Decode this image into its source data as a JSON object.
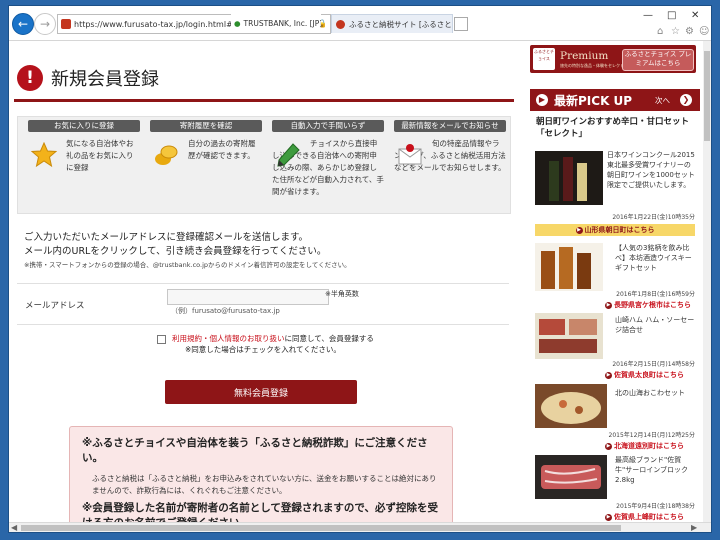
{
  "browser": {
    "url": "https://www.furusato-tax.jp/login.html#registration",
    "addr_tools": "⌕ ▾ 🔒",
    "tab_cert": "TRUSTBANK, Inc. [JP]",
    "tab_active": "ふるさと納税サイト [ふるさとチョ...",
    "tab_close": "×"
  },
  "page": {
    "title": "新規会員登録",
    "features": [
      {
        "label": "お気に入りに登録",
        "text": "気になる自治体やお礼の品をお気に入りに登録"
      },
      {
        "label": "寄附履歴を確認",
        "text": "自分の過去の寄附履歴が確認できます。"
      },
      {
        "label": "自動入力で手間いらず",
        "text": "チョイスから直接申し込みできる自治体への寄附申し込みの際、あらかじめ登録した住所などが自動入力されて、手間が省けます。"
      },
      {
        "label": "最新情報をメールでお知らせ",
        "text": "旬の特産品情報やランキング、ふるさと納税活用方法などをメールでお知らせします。"
      }
    ],
    "info_line1": "ご入力いただいたメールアドレスに登録確認メールを送信します。",
    "info_line2": "メール内のURLをクリックして、引き続き会員登録を行ってください。",
    "info_note": "※携帯・スマートフォンからの登録の場合、@trustbank.co.jpからのドメイン着信許可の設定をしてください。",
    "form": {
      "label": "メールアドレス",
      "required": "※半角英数",
      "example": "（例）furusato@furusato-tax.jp",
      "value": ""
    },
    "agree": {
      "link": "利用規約・個人情報のお取り扱い",
      "rest": "に同意して、会員登録する",
      "note": "※同意した場合はチェックを入れてください。"
    },
    "register_button": "無料会員登録",
    "warning": {
      "title1": "※ふるさとチョイスや自治体を装う「ふるさと納税詐欺」にご注意ください。",
      "para1": "ふるさと納税は「ふるさと納税」をお申込みをされていない方に、送金をお願いすることは絶対にありませんので、詐欺行為には、くれぐれもご注意ください。",
      "title2": "※会員登録した名前が寄附者の名前として登録されますので、必ず控除を受ける方のお名前でご登録ください。"
    }
  },
  "sidebar": {
    "premium_logo": "ふるさとチョイス",
    "premium_word": "Premium",
    "premium_sub": "旅先の特別な逸品・体験をセレクト",
    "premium_btn": "ふるさとチョイス プレミアムはこちら",
    "pick_title": "最新PICK UP",
    "pick_next": "次へ",
    "feature_title": "朝日町ワインおすすめ辛口・甘口セット「セレクト」",
    "items": [
      {
        "desc": "日本ワインコンクール2015東北最多受賞ワイナリーの朝日町ワインを1000セット限定でご提供いたします。",
        "date": "2016年1月22日(金)10時35分",
        "shop": "山形県朝日町はこちら"
      },
      {
        "desc": "【人気の3銘柄を飲み比べ】本坊酒造ウイスキーギフトセット",
        "date": "2016年1月8日(金)16時59分",
        "shop": "長野県宮ケ根市はこちら"
      },
      {
        "desc": "山崎ハム ハム・ソーセージ詰合せ",
        "date": "2016年2月15日(月)14時58分",
        "shop": "佐賀県太良町はこちら"
      },
      {
        "desc": "北の山海おこわセット",
        "date": "2015年12月14日(月)12時25分",
        "shop": "北海道遠別町はこちら"
      },
      {
        "desc": "最高級ブランド\"佐賀牛\"サーロインブロック2.8kg",
        "date": "2015年9月4日(金)18時38分",
        "shop": "佐賀県上峰町はこちら"
      }
    ]
  },
  "colors": {
    "brand": "#8e1517",
    "link": "#c8101b",
    "highlight": "#f7d768"
  }
}
